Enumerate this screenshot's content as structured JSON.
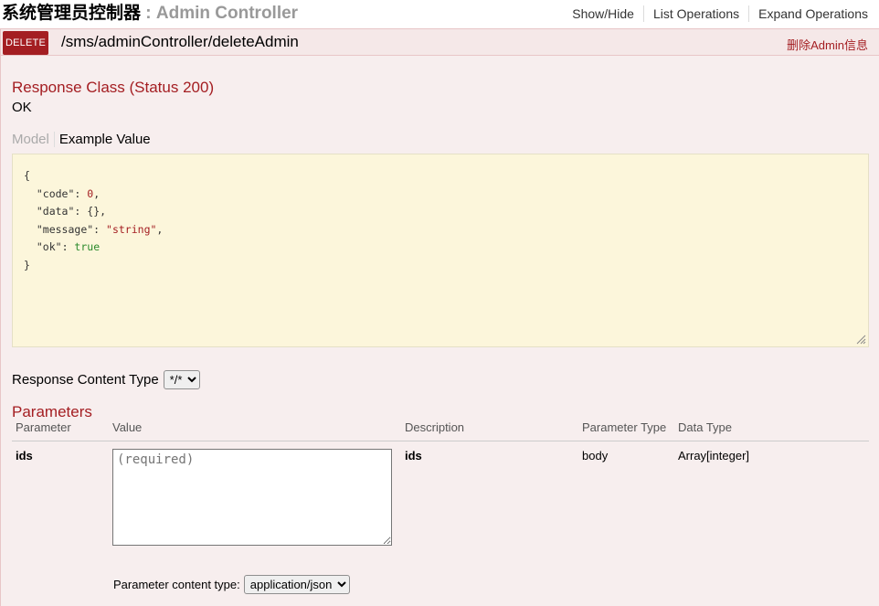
{
  "header": {
    "title_cn": "系统管理员控制器",
    "separator": " : ",
    "title_en": "Admin Controller",
    "links": [
      "Show/Hide",
      "List Operations",
      "Expand Operations"
    ]
  },
  "operation": {
    "method": "DELETE",
    "path": "/sms/adminController/deleteAdmin",
    "summary": "删除Admin信息"
  },
  "response": {
    "class_heading": "Response Class (Status 200)",
    "status_text": "OK",
    "tabs": {
      "model": "Model",
      "example": "Example Value"
    },
    "example_json": {
      "open": "{",
      "close": "}",
      "lines": [
        {
          "key": "\"code\"",
          "value": "0",
          "type": "number",
          "trail": ","
        },
        {
          "key": "\"data\"",
          "value": "{}",
          "type": "plain",
          "trail": ","
        },
        {
          "key": "\"message\"",
          "value": "\"string\"",
          "type": "string",
          "trail": ","
        },
        {
          "key": "\"ok\"",
          "value": "true",
          "type": "bool",
          "trail": ""
        }
      ]
    },
    "content_type_label": "Response Content Type",
    "content_type_value": "*/*"
  },
  "parameters": {
    "heading": "Parameters",
    "columns": {
      "parameter": "Parameter",
      "value": "Value",
      "description": "Description",
      "param_type": "Parameter Type",
      "data_type": "Data Type"
    },
    "rows": [
      {
        "name": "ids",
        "placeholder": "(required)",
        "description": "ids",
        "param_type": "body",
        "data_type": "Array[integer]"
      }
    ],
    "content_type_label": "Parameter content type:",
    "content_type_value": "application/json"
  },
  "colors": {
    "delete_badge": "#a41e22",
    "panel_bg": "#f7eeee",
    "code_bg": "#fcf6db"
  }
}
